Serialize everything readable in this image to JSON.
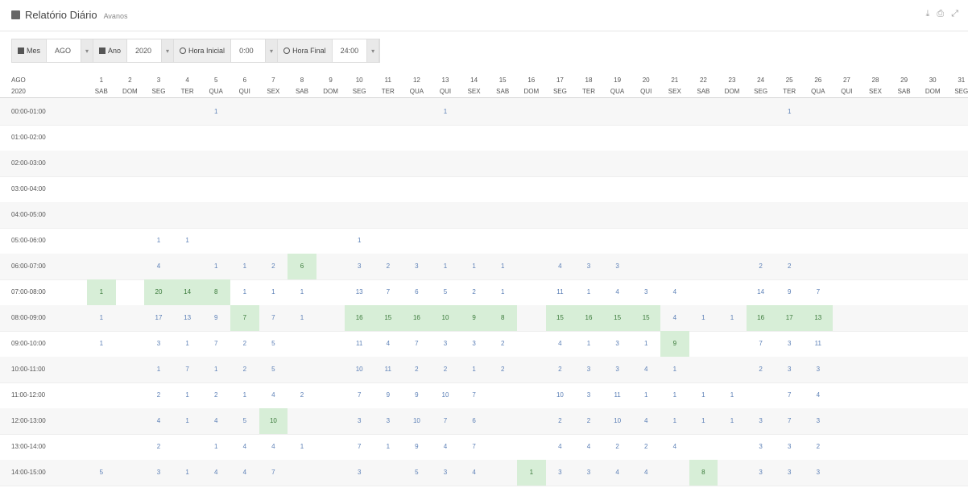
{
  "header": {
    "title": "Relatório Diário",
    "subtitle": "Avanos",
    "icons": [
      "download-icon",
      "print-icon",
      "expand-icon"
    ]
  },
  "filters": {
    "mes_label": "Mes",
    "mes_value": "AGO",
    "ano_label": "Ano",
    "ano_value": "2020",
    "hora_inicial_label": "Hora Inicial",
    "hora_inicial_value": "0:00",
    "hora_final_label": "Hora Final",
    "hora_final_value": "24:00"
  },
  "table": {
    "month_label": "AGO",
    "year_label": "2020",
    "days": [
      "1",
      "2",
      "3",
      "4",
      "5",
      "6",
      "7",
      "8",
      "9",
      "10",
      "11",
      "12",
      "13",
      "14",
      "15",
      "16",
      "17",
      "18",
      "19",
      "20",
      "21",
      "22",
      "23",
      "24",
      "25",
      "26",
      "27",
      "28",
      "29",
      "30",
      "31"
    ],
    "weekdays": [
      "SAB",
      "DOM",
      "SEG",
      "TER",
      "QUA",
      "QUI",
      "SEX",
      "SAB",
      "DOM",
      "SEG",
      "TER",
      "QUA",
      "QUI",
      "SEX",
      "SAB",
      "DOM",
      "SEG",
      "TER",
      "QUA",
      "QUI",
      "SEX",
      "SAB",
      "DOM",
      "SEG",
      "TER",
      "QUA",
      "QUI",
      "SEX",
      "SAB",
      "DOM",
      "SEG"
    ],
    "rows": [
      {
        "label": "00:00-01:00",
        "cells": [
          "",
          "",
          "",
          "",
          "1",
          "",
          "",
          "",
          "",
          "",
          "",
          "",
          "1",
          "",
          "",
          "",
          "",
          "",
          "",
          "",
          "",
          "",
          "",
          "",
          "1",
          "",
          "",
          "",
          "",
          "",
          ""
        ],
        "highlight": []
      },
      {
        "label": "01:00-02:00",
        "cells": [
          "",
          "",
          "",
          "",
          "",
          "",
          "",
          "",
          "",
          "",
          "",
          "",
          "",
          "",
          "",
          "",
          "",
          "",
          "",
          "",
          "",
          "",
          "",
          "",
          "",
          "",
          "",
          "",
          "",
          "",
          ""
        ],
        "highlight": []
      },
      {
        "label": "02:00-03:00",
        "cells": [
          "",
          "",
          "",
          "",
          "",
          "",
          "",
          "",
          "",
          "",
          "",
          "",
          "",
          "",
          "",
          "",
          "",
          "",
          "",
          "",
          "",
          "",
          "",
          "",
          "",
          "",
          "",
          "",
          "",
          "",
          ""
        ],
        "highlight": []
      },
      {
        "label": "03:00-04:00",
        "cells": [
          "",
          "",
          "",
          "",
          "",
          "",
          "",
          "",
          "",
          "",
          "",
          "",
          "",
          "",
          "",
          "",
          "",
          "",
          "",
          "",
          "",
          "",
          "",
          "",
          "",
          "",
          "",
          "",
          "",
          "",
          ""
        ],
        "highlight": []
      },
      {
        "label": "04:00-05:00",
        "cells": [
          "",
          "",
          "",
          "",
          "",
          "",
          "",
          "",
          "",
          "",
          "",
          "",
          "",
          "",
          "",
          "",
          "",
          "",
          "",
          "",
          "",
          "",
          "",
          "",
          "",
          "",
          "",
          "",
          "",
          "",
          ""
        ],
        "highlight": []
      },
      {
        "label": "05:00-06:00",
        "cells": [
          "",
          "",
          "1",
          "1",
          "",
          "",
          "",
          "",
          "",
          "1",
          "",
          "",
          "",
          "",
          "",
          "",
          "",
          "",
          "",
          "",
          "",
          "",
          "",
          "",
          "",
          "",
          "",
          "",
          "",
          "",
          ""
        ],
        "highlight": []
      },
      {
        "label": "06:00-07:00",
        "cells": [
          "",
          "",
          "4",
          "",
          "1",
          "1",
          "2",
          "6",
          "",
          "3",
          "2",
          "3",
          "1",
          "1",
          "1",
          "",
          "4",
          "3",
          "3",
          "",
          "",
          "",
          "",
          "2",
          "2",
          "",
          "",
          "",
          "",
          "",
          ""
        ],
        "highlight": [
          7
        ]
      },
      {
        "label": "07:00-08:00",
        "cells": [
          "1",
          "",
          "20",
          "14",
          "8",
          "1",
          "1",
          "1",
          "",
          "13",
          "7",
          "6",
          "5",
          "2",
          "1",
          "",
          "11",
          "1",
          "4",
          "3",
          "4",
          "",
          "",
          "14",
          "9",
          "7",
          "",
          "",
          "",
          "",
          ""
        ],
        "highlight": [
          0,
          2,
          3,
          4
        ]
      },
      {
        "label": "08:00-09:00",
        "cells": [
          "1",
          "",
          "17",
          "13",
          "9",
          "7",
          "7",
          "1",
          "",
          "16",
          "15",
          "16",
          "10",
          "9",
          "8",
          "",
          "15",
          "16",
          "15",
          "15",
          "4",
          "1",
          "1",
          "16",
          "17",
          "13",
          "",
          "",
          "",
          "",
          ""
        ],
        "highlight": [
          5,
          9,
          10,
          11,
          12,
          13,
          14,
          16,
          17,
          18,
          19,
          23,
          24,
          25
        ]
      },
      {
        "label": "09:00-10:00",
        "cells": [
          "1",
          "",
          "3",
          "1",
          "7",
          "2",
          "5",
          "",
          "",
          "11",
          "4",
          "7",
          "3",
          "3",
          "2",
          "",
          "4",
          "1",
          "3",
          "1",
          "9",
          "",
          "",
          "7",
          "3",
          "11",
          "",
          "",
          "",
          "",
          ""
        ],
        "highlight": [
          20
        ]
      },
      {
        "label": "10:00-11:00",
        "cells": [
          "",
          "",
          "1",
          "7",
          "1",
          "2",
          "5",
          "",
          "",
          "10",
          "11",
          "2",
          "2",
          "1",
          "2",
          "",
          "2",
          "3",
          "3",
          "4",
          "1",
          "",
          "",
          "2",
          "3",
          "3",
          "",
          "",
          "",
          "",
          ""
        ],
        "highlight": []
      },
      {
        "label": "11:00-12:00",
        "cells": [
          "",
          "",
          "2",
          "1",
          "2",
          "1",
          "4",
          "2",
          "",
          "7",
          "9",
          "9",
          "10",
          "7",
          "",
          "",
          "10",
          "3",
          "11",
          "1",
          "1",
          "1",
          "1",
          "",
          "7",
          "4",
          "",
          "",
          "",
          "",
          ""
        ],
        "highlight": []
      },
      {
        "label": "12:00-13:00",
        "cells": [
          "",
          "",
          "4",
          "1",
          "4",
          "5",
          "10",
          "",
          "",
          "3",
          "3",
          "10",
          "7",
          "6",
          "",
          "",
          "2",
          "2",
          "10",
          "4",
          "1",
          "1",
          "1",
          "3",
          "7",
          "3",
          "",
          "",
          "",
          "",
          ""
        ],
        "highlight": [
          6
        ]
      },
      {
        "label": "13:00-14:00",
        "cells": [
          "",
          "",
          "2",
          "",
          "1",
          "4",
          "4",
          "1",
          "",
          "7",
          "1",
          "9",
          "4",
          "7",
          "",
          "",
          "4",
          "4",
          "2",
          "2",
          "4",
          "",
          "",
          "3",
          "3",
          "2",
          "",
          "",
          "",
          "",
          ""
        ],
        "highlight": []
      },
      {
        "label": "14:00-15:00",
        "cells": [
          "5",
          "",
          "3",
          "1",
          "4",
          "4",
          "7",
          "",
          "",
          "3",
          "",
          "5",
          "3",
          "4",
          "",
          "1",
          "3",
          "3",
          "4",
          "4",
          "",
          "8",
          "",
          "3",
          "3",
          "3",
          "",
          "",
          "",
          "",
          ""
        ],
        "highlight": [
          15,
          21
        ]
      }
    ]
  }
}
